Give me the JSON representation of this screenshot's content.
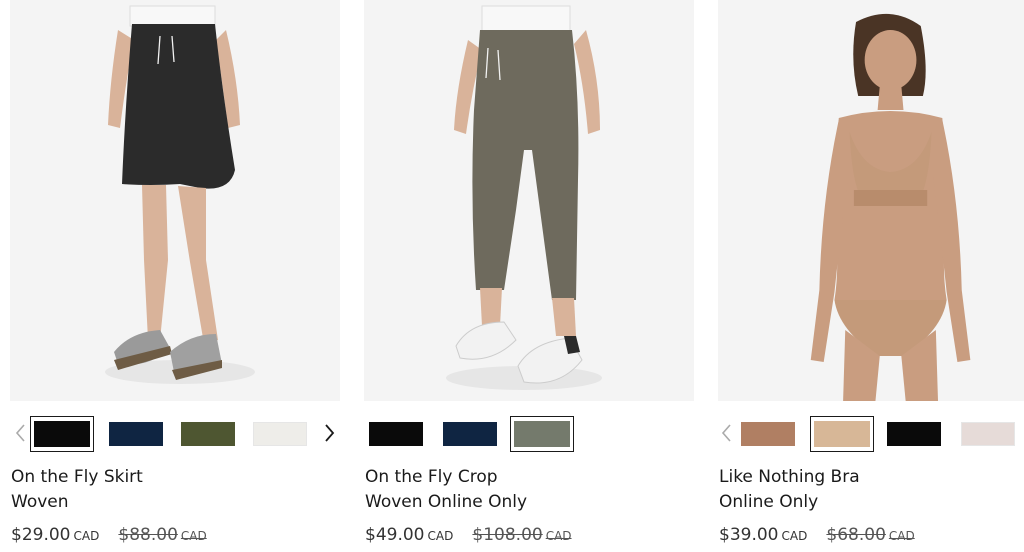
{
  "products": [
    {
      "name_line1": "On the Fly Skirt",
      "name_line2": "Woven",
      "price": "$29.00",
      "price_currency": "CAD",
      "original_price": "$88.00",
      "original_currency": "CAD",
      "has_prev_arrow": true,
      "has_next_arrow": true,
      "swatches": [
        {
          "color": "#0a0a0a",
          "selected": true
        },
        {
          "color": "#0f2542",
          "selected": false
        },
        {
          "color": "#4e5631",
          "selected": false
        },
        {
          "color": "#eeede9",
          "selected": false
        }
      ],
      "photo": {
        "icon": "skirt-model-photo",
        "garment_color": "#2b2b2b"
      }
    },
    {
      "name_line1": "On the Fly Crop",
      "name_line2": "Woven Online Only",
      "price": "$49.00",
      "price_currency": "CAD",
      "original_price": "$108.00",
      "original_currency": "CAD",
      "has_prev_arrow": false,
      "has_next_arrow": false,
      "swatches": [
        {
          "color": "#0a0a0a",
          "selected": false
        },
        {
          "color": "#0f2542",
          "selected": false
        },
        {
          "color": "#747a6c",
          "selected": true
        }
      ],
      "photo": {
        "icon": "crop-pants-model-photo",
        "garment_color": "#6e6a5d"
      }
    },
    {
      "name_line1": "Like Nothing Bra",
      "name_line2": "Online Only",
      "price": "$39.00",
      "price_currency": "CAD",
      "original_price": "$68.00",
      "original_currency": "CAD",
      "has_prev_arrow": true,
      "has_next_arrow": false,
      "swatches": [
        {
          "color": "#b07f63",
          "selected": false
        },
        {
          "color": "#d7b797",
          "selected": true
        },
        {
          "color": "#0a0a0a",
          "selected": false
        },
        {
          "color": "#e6dbd8",
          "selected": false
        }
      ],
      "photo": {
        "icon": "bra-model-photo",
        "garment_color": "#c49a7a"
      }
    }
  ],
  "icons": {
    "prev": "chevron-left-icon",
    "next": "chevron-right-icon"
  }
}
